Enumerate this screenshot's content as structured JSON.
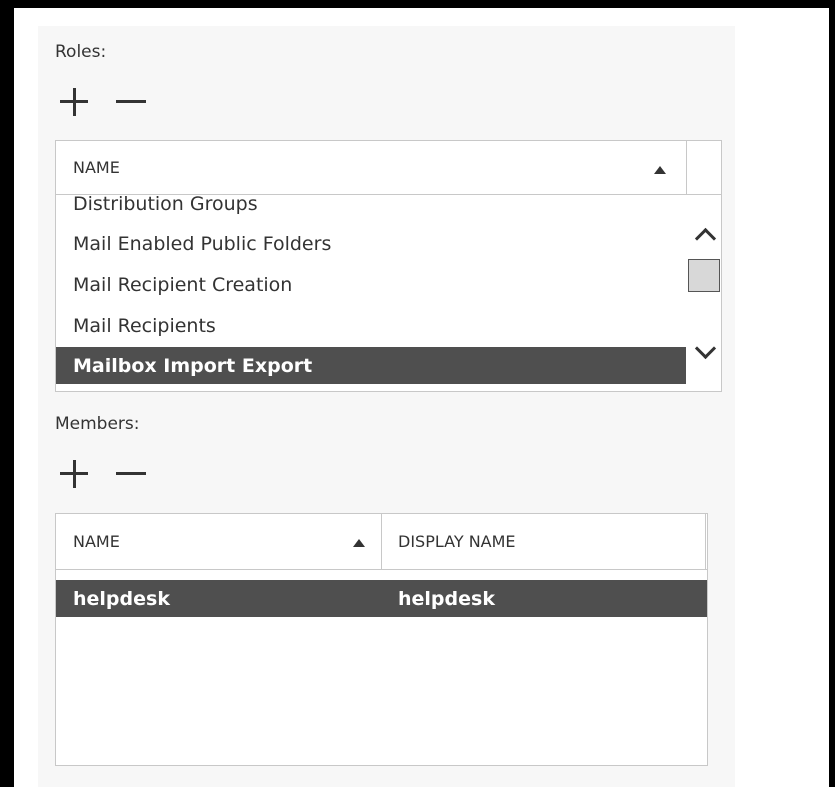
{
  "roles": {
    "label": "Roles:",
    "add_icon": "plus-icon",
    "remove_icon": "minus-icon",
    "column_header": "NAME",
    "items": [
      "Distribution Groups",
      "Mail Enabled Public Folders",
      "Mail Recipient Creation",
      "Mail Recipients",
      "Mailbox Import Export"
    ],
    "selected_item": "Mailbox Import Export"
  },
  "members": {
    "label": "Members:",
    "add_icon": "plus-icon",
    "remove_icon": "minus-icon",
    "columns": [
      "NAME",
      "DISPLAY NAME"
    ],
    "rows": [
      {
        "name": "helpdesk",
        "display_name": "helpdesk"
      }
    ]
  },
  "colors": {
    "selection_background": "#4f4f4f",
    "selection_text": "#ffffff",
    "panel_background": "#f7f7f7"
  }
}
